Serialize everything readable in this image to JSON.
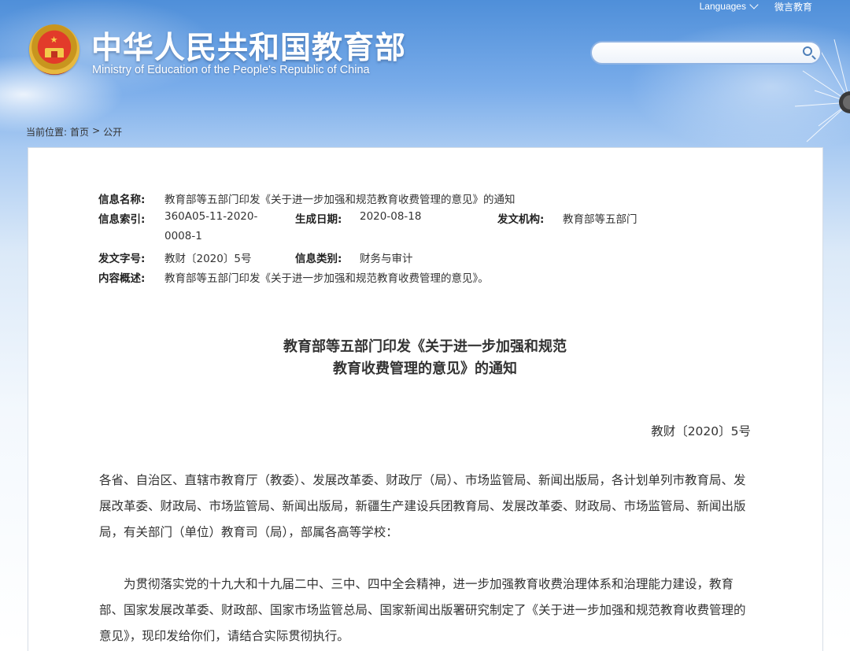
{
  "header": {
    "languages_label": "Languages",
    "weibo_label": "微言教育",
    "title_cn": "中华人民共和国教育部",
    "title_en": "Ministry of Education of the People's Republic of China",
    "search_placeholder": ""
  },
  "breadcrumb": {
    "prefix": "当前位置:",
    "home": "首页",
    "separator": ">",
    "current": "公开"
  },
  "meta": {
    "info_name_label": "信息名称:",
    "info_name_value": "教育部等五部门印发《关于进一步加强和规范教育收费管理的意见》的通知",
    "index_label": "信息索引:",
    "index_value_line1": "360A05-11-2020-",
    "index_value_line2": "0008-1",
    "date_label": "生成日期:",
    "date_value": "2020-08-18",
    "issuer_label": "发文机构:",
    "issuer_value": "教育部等五部门",
    "docno_label": "发文字号:",
    "docno_value": "教财〔2020〕5号",
    "category_label": "信息类别:",
    "category_value": "财务与审计",
    "summary_label": "内容概述:",
    "summary_value": "教育部等五部门印发《关于进一步加强和规范教育收费管理的意见》。"
  },
  "document": {
    "title_line1": "教育部等五部门印发《关于进一步加强和规范",
    "title_line2": "教育收费管理的意见》的通知",
    "number": "教财〔2020〕5号",
    "recipients": "各省、自治区、直辖市教育厅（教委）、发展改革委、财政厅（局）、市场监管局、新闻出版局，各计划单列市教育局、发展改革委、财政局、市场监管局、新闻出版局，新疆生产建设兵团教育局、发展改革委、财政局、市场监管局、新闻出版局，有关部门（单位）教育司（局），部属各高等学校：",
    "body_p1": "为贯彻落实党的十九大和十九届二中、三中、四中全会精神，进一步加强教育收费治理体系和治理能力建设，教育部、国家发展改革委、财政部、国家市场监管总局、国家新闻出版署研究制定了《关于进一步加强和规范教育收费管理的意见》，现印发给你们，请结合实际贯彻执行。"
  }
}
